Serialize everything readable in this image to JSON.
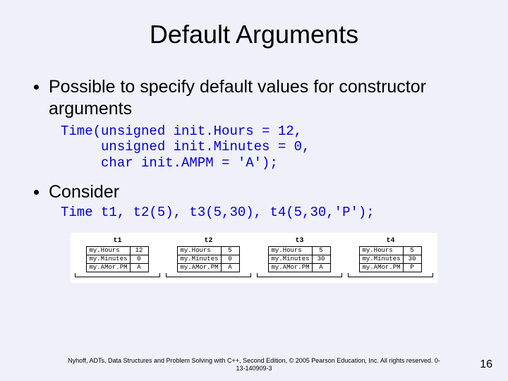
{
  "title": "Default Arguments",
  "bullet1": "Possible to specify default values for constructor arguments",
  "code1": "Time(unsigned init.Hours = 12,\n     unsigned init.Minutes = 0,\n     char init.AMPM = 'A');",
  "bullet2": "Consider",
  "code2": "Time t1, t2(5), t3(5,30), t4(5,30,'P');",
  "objects": [
    {
      "name": "t1",
      "fields": [
        "my.Hours",
        "my.Minutes",
        "my.AMor.PM"
      ],
      "vals": [
        "12",
        "0",
        "A"
      ]
    },
    {
      "name": "t2",
      "fields": [
        "my.Hours",
        "my.Minutes",
        "my.AMor.PM"
      ],
      "vals": [
        "5",
        "0",
        "A"
      ]
    },
    {
      "name": "t3",
      "fields": [
        "my.Hours",
        "my.Minutes",
        "my.AMor.PM"
      ],
      "vals": [
        "5",
        "30",
        "A"
      ]
    },
    {
      "name": "t4",
      "fields": [
        "my.Hours",
        "my.Minutes",
        "my.AMor.PM"
      ],
      "vals": [
        "5",
        "30",
        "P"
      ]
    }
  ],
  "footer": "Nyhoff, ADTs, Data Structures and Problem Solving with C++, Second Edition, © 2005 Pearson Education, Inc. All rights reserved. 0-13-140909-3",
  "page": "16"
}
